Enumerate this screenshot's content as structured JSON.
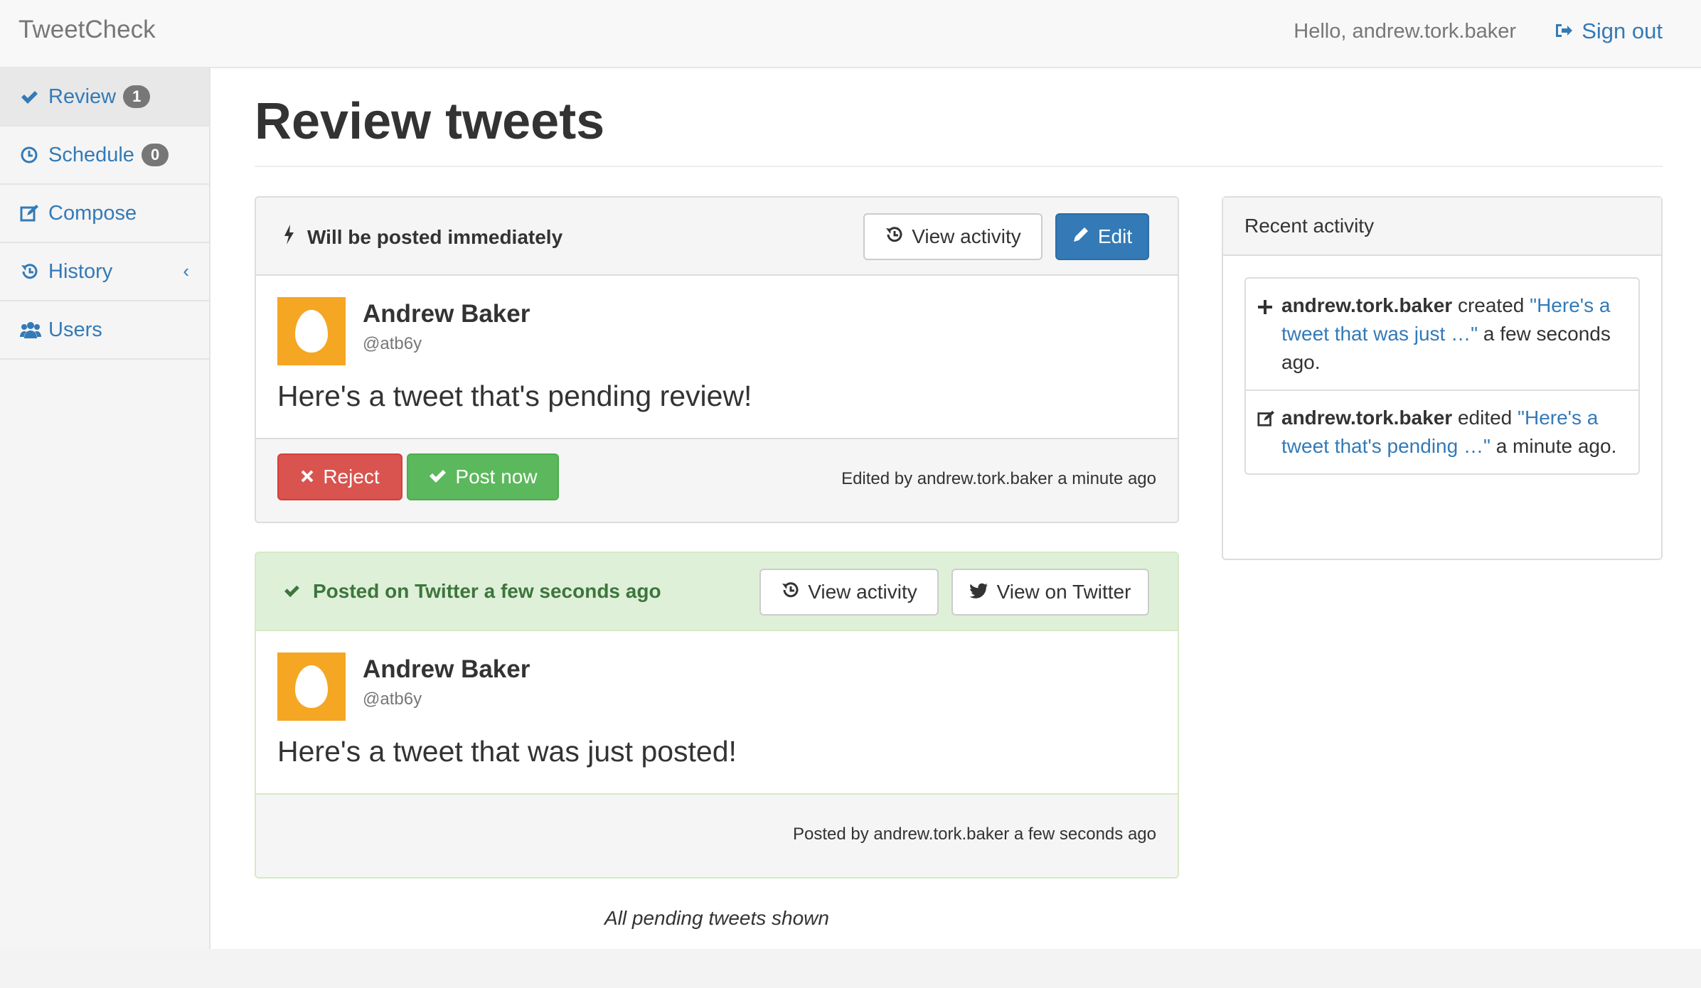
{
  "navbar": {
    "brand": "TweetCheck",
    "greeting": "Hello, andrew.tork.baker",
    "signout_label": "Sign out"
  },
  "sidebar": {
    "items": [
      {
        "label": "Review",
        "icon": "check-icon",
        "badge": "1"
      },
      {
        "label": "Schedule",
        "icon": "clock-icon",
        "badge": "0"
      },
      {
        "label": "Compose",
        "icon": "edit-icon"
      },
      {
        "label": "History",
        "icon": "history-icon",
        "chevron": "‹"
      },
      {
        "label": "Users",
        "icon": "users-icon"
      }
    ]
  },
  "main": {
    "title": "Review tweets",
    "tweets": [
      {
        "status": "Will be posted immediately",
        "status_icon": "bolt-icon",
        "view_activity_label": "View activity",
        "edit_label": "Edit",
        "author": "Andrew Baker",
        "handle": "@atb6y",
        "text": "Here's a tweet that's pending review!",
        "reject_label": "Reject",
        "post_now_label": "Post now",
        "meta": "Edited by andrew.tork.baker a minute ago"
      },
      {
        "status": "Posted on Twitter a few seconds ago",
        "status_icon": "check-icon",
        "view_activity_label": "View activity",
        "view_twitter_label": "View on Twitter",
        "author": "Andrew Baker",
        "handle": "@atb6y",
        "text": "Here's a tweet that was just posted!",
        "meta": "Posted by andrew.tork.baker a few seconds ago"
      }
    ],
    "footer_note": "All pending tweets shown"
  },
  "recent_activity": {
    "title": "Recent activity",
    "items": [
      {
        "icon": "plus-icon",
        "user": "andrew.tork.baker",
        "action": "created",
        "link": "\"Here's a tweet that was just …\"",
        "time": "a few seconds ago."
      },
      {
        "icon": "edit-icon",
        "user": "andrew.tork.baker",
        "action": "edited",
        "link": "\"Here's a tweet that's pending …\"",
        "time": "a minute ago."
      }
    ]
  },
  "colors": {
    "link": "#337ab7",
    "danger": "#d9534f",
    "success": "#5cb85c",
    "success_bg": "#dff0d8",
    "avatar": "#f5a623"
  }
}
